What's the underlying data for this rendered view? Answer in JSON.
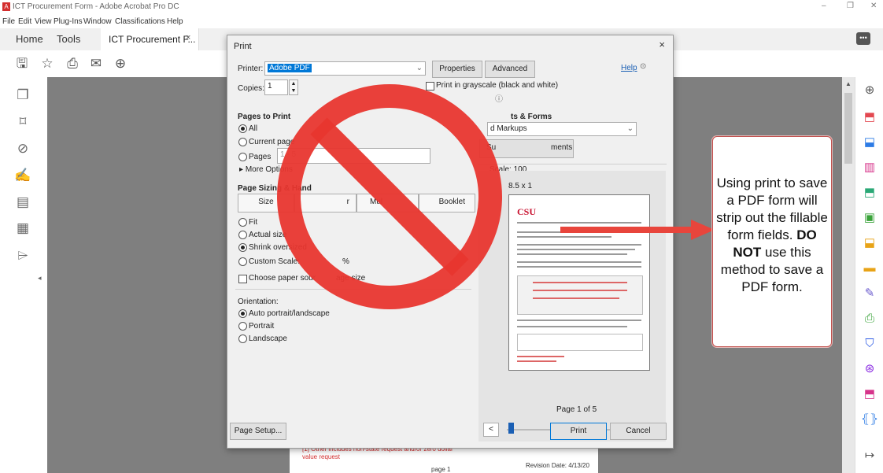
{
  "window": {
    "title": "ICT Procurement Form - Adobe Acrobat Pro DC",
    "app_icon_label": "A",
    "min": "–",
    "restore": "❐",
    "close": "✕"
  },
  "menu": [
    "File",
    "Edit",
    "View",
    "Plug-Ins",
    "Window",
    "Classifications",
    "Help"
  ],
  "tabs": {
    "home": "Home",
    "tools": "Tools",
    "document": "ICT Procurement F...",
    "document_close": "×"
  },
  "toolbar_icons": [
    "save-icon",
    "bookmark-star-icon",
    "print-icon",
    "email-icon",
    "search-zoom-icon"
  ],
  "left_rail_icons": [
    "pages-icon",
    "bookmark-icon",
    "attachment-icon",
    "signature-icon",
    "document-icon",
    "layers-icon",
    "tag-icon"
  ],
  "right_rail_icons": [
    "zoom-icon",
    "export-pdf-icon",
    "create-pdf-icon",
    "edit-pdf-icon",
    "comment-icon",
    "combine-icon",
    "organize-icon",
    "sticky-note-icon",
    "fill-sign-icon",
    "scan-icon",
    "protect-icon",
    "accessibility-icon",
    "print-production-icon",
    "more-tools-icon",
    "collapse-icon"
  ],
  "background_page": {
    "note": "[1] Other includes non-state request and/or zero dollar value request",
    "page": "page 1",
    "revision": "Revision Date: 4/13/20"
  },
  "print_dialog": {
    "title": "Print",
    "close": "×",
    "printer_label": "Printer:",
    "printer_value": "Adobe PDF",
    "properties": "Properties",
    "advanced": "Advanced",
    "help": "Help",
    "copies_label": "Copies:",
    "copies_value": "1",
    "grayscale": "Print in grayscale (black and white)",
    "pages_to_print": "Pages to Print",
    "all": "All",
    "current_page": "Current page",
    "pages": "Pages",
    "pages_value": "1 - 5",
    "more_options": "More Options",
    "page_sizing": "Page Sizing & Hand",
    "size_tab": "Size",
    "poster_tab": "r",
    "multiple_tab": "Mul",
    "booklet_tab": "Booklet",
    "fit": "Fit",
    "actual_size": "Actual size",
    "shrink": "Shrink oversized",
    "custom_scale": "Custom Scale:",
    "percent": "%",
    "paper_source": "Choose paper sour",
    "paper_source_tail": "age size",
    "orientation": "Orientation:",
    "auto": "Auto portrait/landscape",
    "portrait": "Portrait",
    "landscape": "Landscape",
    "comments_forms": "ts & Forms",
    "comments_value": "d Markups",
    "summarize_prefix": "Su",
    "summarize_suffix": "ments",
    "scale": "Scale: 100",
    "paper_size": "8.5 x 1",
    "preview_heading": "CSU",
    "page_of": "Page 1 of 5",
    "prev": "<",
    "next": ">",
    "page_setup": "Page Setup...",
    "print": "Print",
    "cancel": "Cancel"
  },
  "callout": {
    "text_before": "Using print to save a PDF form will strip out the fillable form fields.",
    "emphasis": "DO NOT",
    "text_after": "use this method to save a PDF form."
  },
  "colors": {
    "prohibition_red": "#e8362f",
    "arrow_red": "#e8453c",
    "callout_border": "#c0504d",
    "printer_highlight": "#0078d7"
  }
}
